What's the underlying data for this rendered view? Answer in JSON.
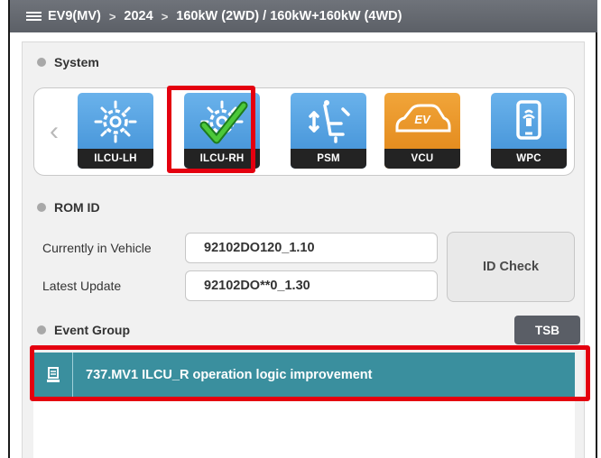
{
  "breadcrumb": {
    "icon": "vehicle-list-icon",
    "items": [
      "EV9(MV)",
      "2024",
      "160kW (2WD) / 160kW+160kW (4WD)"
    ],
    "separator": ">"
  },
  "system": {
    "title": "System",
    "modules": [
      {
        "label": "ILCU-LH",
        "icon": "lamp-gear-icon",
        "color": "#4a9ae0",
        "selected": false
      },
      {
        "label": "ILCU-RH",
        "icon": "lamp-gear-check-icon",
        "color": "#4a9ae0",
        "selected": true
      },
      {
        "label": "PSM",
        "icon": "power-seat-icon",
        "color": "#4a9ae0",
        "selected": false
      },
      {
        "label": "VCU",
        "icon": "ev-car-icon",
        "color": "#ea9420",
        "selected": false
      },
      {
        "label": "WPC",
        "icon": "wireless-phone-charger-icon",
        "color": "#4a9ae0",
        "selected": false
      }
    ],
    "prev_arrow": "‹",
    "next_arrow": "›"
  },
  "rom_id": {
    "title": "ROM ID",
    "current_label": "Currently in Vehicle",
    "current_value": "92102DO120_1.10",
    "latest_label": "Latest Update",
    "latest_value": "92102DO**0_1.30",
    "id_check_label": "ID Check"
  },
  "event_group": {
    "title": "Event Group",
    "tsb_label": "TSB",
    "events": [
      {
        "icon": "document-stamp-icon",
        "text": "737.MV1 ILCU_R operation logic improvement"
      }
    ]
  },
  "colors": {
    "highlight": "#e4000f",
    "event_row": "#3a8f9e",
    "tile_blue": "#4a9ae0",
    "tile_orange": "#ea9420"
  }
}
